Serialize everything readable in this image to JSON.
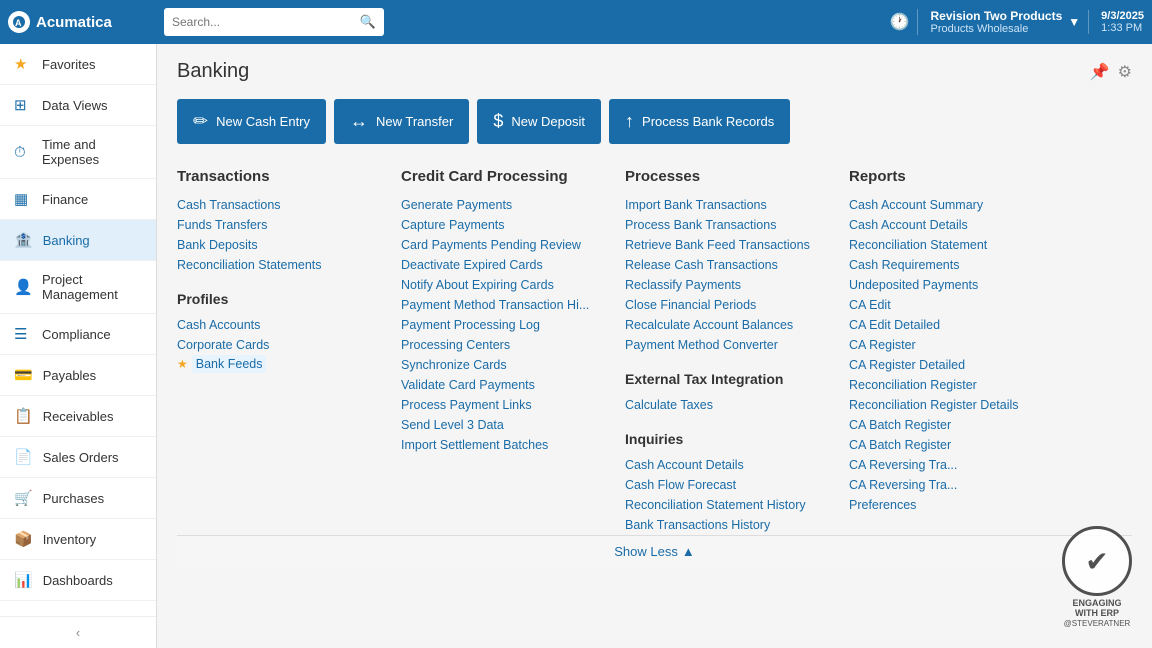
{
  "topbar": {
    "logo_text": "Acumatica",
    "search_placeholder": "Search...",
    "company_name": "Revision Two Products",
    "sub_name": "Products Wholesale",
    "date": "9/3/2025",
    "time": "1:33 PM",
    "history_icon": "🕐"
  },
  "sidebar": {
    "items": [
      {
        "id": "favorites",
        "label": "Favorites",
        "icon": "★"
      },
      {
        "id": "data-views",
        "label": "Data Views",
        "icon": "⊞"
      },
      {
        "id": "time-expenses",
        "label": "Time and Expenses",
        "icon": "⏱"
      },
      {
        "id": "finance",
        "label": "Finance",
        "icon": "▦"
      },
      {
        "id": "banking",
        "label": "Banking",
        "icon": "🏦"
      },
      {
        "id": "project-mgmt",
        "label": "Project Management",
        "icon": "👤"
      },
      {
        "id": "compliance",
        "label": "Compliance",
        "icon": "☰"
      },
      {
        "id": "payables",
        "label": "Payables",
        "icon": "💳"
      },
      {
        "id": "receivables",
        "label": "Receivables",
        "icon": "📋"
      },
      {
        "id": "sales-orders",
        "label": "Sales Orders",
        "icon": "📄"
      },
      {
        "id": "purchases",
        "label": "Purchases",
        "icon": "🛒"
      },
      {
        "id": "inventory",
        "label": "Inventory",
        "icon": "📦"
      },
      {
        "id": "dashboards",
        "label": "Dashboards",
        "icon": "📊"
      }
    ],
    "collapse_label": "‹"
  },
  "page": {
    "title": "Banking",
    "pin_icon": "📌",
    "settings_icon": "⚙"
  },
  "quick_actions": [
    {
      "id": "new-cash-entry",
      "label": "New Cash Entry",
      "icon": "✏"
    },
    {
      "id": "new-transfer",
      "label": "New Transfer",
      "icon": "↔"
    },
    {
      "id": "new-deposit",
      "label": "New Deposit",
      "icon": "$"
    },
    {
      "id": "process-bank-records",
      "label": "Process Bank Records",
      "icon": "↑"
    }
  ],
  "menu": {
    "transactions": {
      "title": "Transactions",
      "links": [
        "Cash Transactions",
        "Funds Transfers",
        "Bank Deposits",
        "Reconciliation Statements"
      ]
    },
    "profiles": {
      "title": "Profiles",
      "links": [
        "Cash Accounts",
        "Corporate Cards",
        "Bank Feeds"
      ]
    },
    "credit_card": {
      "title": "Credit Card Processing",
      "links": [
        "Generate Payments",
        "Capture Payments",
        "Card Payments Pending Review",
        "Deactivate Expired Cards",
        "Notify About Expiring Cards",
        "Payment Method Transaction Hi...",
        "Payment Processing Log",
        "Processing Centers",
        "Synchronize Cards",
        "Validate Card Payments",
        "Process Payment Links",
        "Send Level 3 Data",
        "Import Settlement Batches"
      ]
    },
    "processes": {
      "title": "Processes",
      "links": [
        "Import Bank Transactions",
        "Process Bank Transactions",
        "Retrieve Bank Feed Transactions",
        "Release Cash Transactions",
        "Reclassify Payments",
        "Close Financial Periods",
        "Recalculate Account Balances",
        "Payment Method Converter"
      ]
    },
    "external_tax": {
      "title": "External Tax Integration",
      "links": [
        "Calculate Taxes"
      ]
    },
    "inquiries": {
      "title": "Inquiries",
      "links": [
        "Cash Account Details",
        "Cash Flow Forecast",
        "Reconciliation Statement History",
        "Bank Transactions History"
      ]
    },
    "reports": {
      "title": "Reports",
      "links": [
        "Cash Account Summary",
        "Cash Account Details",
        "Reconciliation Statement",
        "Cash Requirements",
        "Undeposited Payments",
        "CA Edit",
        "CA Edit Detailed",
        "CA Register",
        "CA Register Detailed",
        "Reconciliation Register",
        "Reconciliation Register Details",
        "CA Batch Register",
        "CA Batch Register",
        "CA Reversing Tra...",
        "CA Reversing Tra...",
        "Preferences"
      ]
    }
  },
  "show_less": "Show Less",
  "bank_feeds_star": "★"
}
